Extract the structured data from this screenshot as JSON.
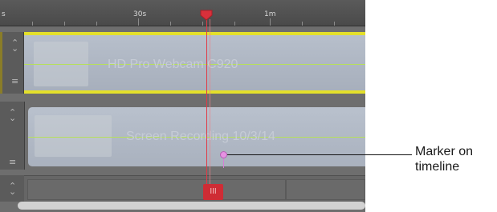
{
  "ruler": {
    "left_label": "s",
    "label_30s": "30s",
    "label_1m": "1m"
  },
  "tracks": [
    {
      "clip_title": "HD Pro Webcam C920"
    },
    {
      "clip_title": "Screen Recording 10/3/14"
    }
  ],
  "playhead": {
    "tail_glyph": "III",
    "color": "#e23a46"
  },
  "marker": {
    "color": "#e592e2"
  },
  "callout": {
    "text": "Marker on timeline"
  },
  "colors": {
    "track_highlight": "#e4e02a",
    "audio_line": "#b6e05a"
  }
}
